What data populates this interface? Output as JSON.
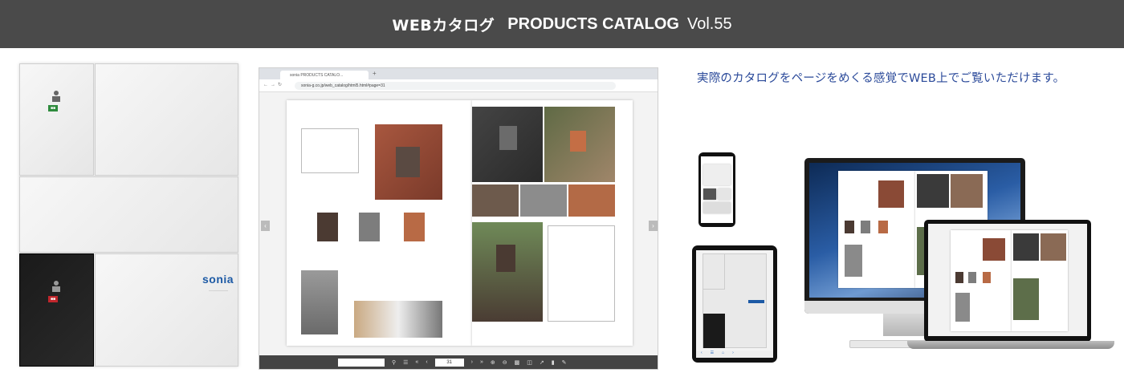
{
  "header": {
    "title_jp": "WEBカタログ",
    "title_en": "PRODUCTS CATALOG",
    "volume": "Vol.55"
  },
  "cover": {
    "brand": "sonia"
  },
  "browser": {
    "tab_title": "sonia PRODUCTS CATALO...",
    "url": "sonia-g.co.jp/web_catalog/html5.html#page=31",
    "page_number": "31"
  },
  "description": "実際のカタログをページをめくる感覚でWEB上でご覧いただけます。",
  "icons": {
    "prev": "chevron-left-icon",
    "next": "chevron-right-icon"
  }
}
